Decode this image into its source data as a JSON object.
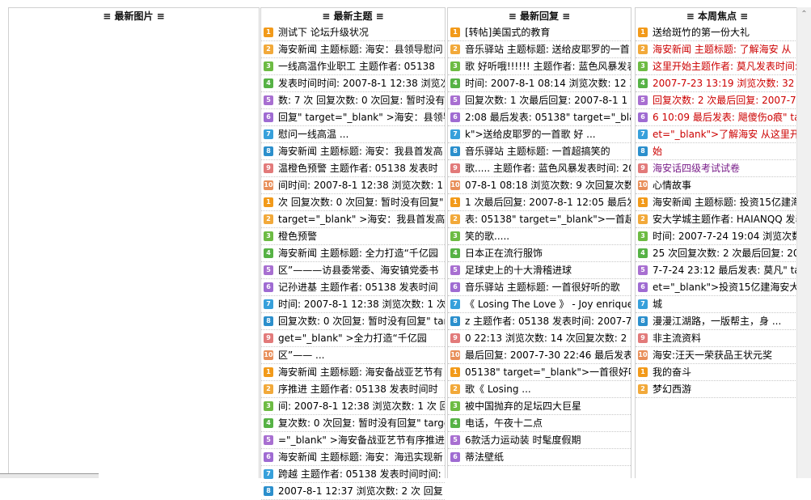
{
  "columns": {
    "pics": {
      "title": "≡ 最新图片 ≡",
      "rows": []
    },
    "topics": {
      "title": "≡ 最新主题 ≡",
      "rows": [
        {
          "num": "1",
          "text": "测试下 论坛升级状况",
          "style": ""
        },
        {
          "num": "2",
          "text": "海安新闻 主题标题: 海安：县领导慰问",
          "style": ""
        },
        {
          "num": "3",
          "text": "一线高温作业职工 主题作者: 05138",
          "style": ""
        },
        {
          "num": "4",
          "text": "发表时间时间: 2007-8-1 12:38 浏览次",
          "style": ""
        },
        {
          "num": "5",
          "text": "数: 7 次 回复次数: 0 次回复: 暂时没有",
          "style": ""
        },
        {
          "num": "6",
          "text": "回复\" target=\"_blank\" >海安：县领导",
          "style": ""
        },
        {
          "num": "7",
          "text": "慰问一线高温 ...",
          "style": ""
        },
        {
          "num": "8",
          "text": "海安新闻 主题标题: 海安：我县首发高",
          "style": ""
        },
        {
          "num": "9",
          "text": "温橙色预警 主题作者: 05138 发表时",
          "style": ""
        },
        {
          "num": "10",
          "text": "间时间: 2007-8-1 12:38 浏览次数: 1",
          "style": ""
        },
        {
          "num": "1",
          "text": "次 回复次数: 0 次回复: 暂时没有回复\"",
          "style": ""
        },
        {
          "num": "2",
          "text": "target=\"_blank\" >海安：我县首发高温",
          "style": ""
        },
        {
          "num": "3",
          "text": "橙色预警",
          "style": ""
        },
        {
          "num": "4",
          "text": "海安新闻 主题标题: 全力打造“千亿园",
          "style": ""
        },
        {
          "num": "5",
          "text": "区”———访县委常委、海安镇党委书",
          "style": ""
        },
        {
          "num": "6",
          "text": "记孙进基 主题作者: 05138 发表时间",
          "style": ""
        },
        {
          "num": "7",
          "text": "时间: 2007-8-1 12:38 浏览次数: 1 次",
          "style": ""
        },
        {
          "num": "8",
          "text": "回复次数: 0 次回复: 暂时没有回复\" tar",
          "style": ""
        },
        {
          "num": "9",
          "text": "get=\"_blank\" >全力打造“千亿园",
          "style": ""
        },
        {
          "num": "10",
          "text": "区”—— ...",
          "style": ""
        },
        {
          "num": "1",
          "text": "海安新闻 主题标题: 海安备战亚艺节有",
          "style": ""
        },
        {
          "num": "2",
          "text": "序推进 主题作者: 05138 发表时间时",
          "style": ""
        },
        {
          "num": "3",
          "text": "间: 2007-8-1 12:38 浏览次数: 1 次 回",
          "style": ""
        },
        {
          "num": "4",
          "text": "复次数: 0 次回复: 暂时没有回复\" target",
          "style": ""
        },
        {
          "num": "5",
          "text": "=\"_blank\" >海安备战亚艺节有序推进",
          "style": ""
        },
        {
          "num": "6",
          "text": "海安新闻 主题标题: 海安：海迅实现新",
          "style": ""
        },
        {
          "num": "7",
          "text": "跨越 主题作者: 05138 发表时间时间:",
          "style": ""
        },
        {
          "num": "8",
          "text": "2007-8-1 12:37 浏览次数: 2 次 回复",
          "style": ""
        }
      ]
    },
    "replies": {
      "title": "≡ 最新回复 ≡",
      "rows": [
        {
          "num": "1",
          "text": "[转帖]美国式的教育",
          "style": ""
        },
        {
          "num": "2",
          "text": "音乐驿站 主题标题: 送给皮耶罗的一首",
          "style": ""
        },
        {
          "num": "3",
          "text": "歌 好听哦!!!!!! 主题作者: 蓝色风暴发表",
          "style": ""
        },
        {
          "num": "4",
          "text": "时间: 2007-8-1 08:14 浏览次数: 12 次",
          "style": ""
        },
        {
          "num": "5",
          "text": "回复次数: 1 次最后回复: 2007-8-1 1",
          "style": ""
        },
        {
          "num": "6",
          "text": "2:08 最后发表: 05138\" target=\"_blan",
          "style": ""
        },
        {
          "num": "7",
          "text": "k\">送给皮耶罗的一首歌 好 ...",
          "style": ""
        },
        {
          "num": "8",
          "text": "音乐驿站 主题标题: 一首超搞笑的",
          "style": ""
        },
        {
          "num": "9",
          "text": "歌..... 主题作者: 蓝色风暴发表时间: 20",
          "style": ""
        },
        {
          "num": "10",
          "text": "07-8-1 08:18 浏览次数: 9 次回复次数:",
          "style": ""
        },
        {
          "num": "1",
          "text": "1 次最后回复: 2007-8-1 12:05 最后发",
          "style": ""
        },
        {
          "num": "2",
          "text": "表: 05138\" target=\"_blank\">一首超搞",
          "style": ""
        },
        {
          "num": "3",
          "text": "笑的歌.....",
          "style": ""
        },
        {
          "num": "4",
          "text": "日本正在流行服饰",
          "style": ""
        },
        {
          "num": "5",
          "text": "足球史上的十大滑稽进球",
          "style": ""
        },
        {
          "num": "6",
          "text": "音乐驿站 主题标题: 一首很好听的歌",
          "style": ""
        },
        {
          "num": "7",
          "text": "《 Losing The Love 》 - Joy enrique",
          "style": ""
        },
        {
          "num": "8",
          "text": "z 主题作者: 05138 发表时间: 2007-7-3",
          "style": ""
        },
        {
          "num": "9",
          "text": "0 22:13 浏览次数: 14 次回复次数: 2 次",
          "style": ""
        },
        {
          "num": "10",
          "text": "最后回复: 2007-7-30 22:46 最后发表:",
          "style": ""
        },
        {
          "num": "1",
          "text": "05138\" target=\"_blank\">一首很好听的",
          "style": ""
        },
        {
          "num": "2",
          "text": "歌《 Losing ...",
          "style": ""
        },
        {
          "num": "3",
          "text": "被中国抛弃的足坛四大巨星",
          "style": ""
        },
        {
          "num": "4",
          "text": "电话，午夜十二点",
          "style": ""
        },
        {
          "num": "5",
          "text": "6款活力运动装 时髦度假期",
          "style": ""
        },
        {
          "num": "6",
          "text": "蒂法壁纸",
          "style": ""
        }
      ]
    },
    "focus": {
      "title": "≡ 本周焦点 ≡",
      "rows": [
        {
          "num": "1",
          "text": "送给斑竹的第一份大礼",
          "style": ""
        },
        {
          "num": "2",
          "text": "海安新闻 主题标题: 了解海安 从",
          "style": "red"
        },
        {
          "num": "3",
          "text": "这里开始主题作者: 莫凡发表时间:",
          "style": "red"
        },
        {
          "num": "4",
          "text": "2007-7-23 13:19 浏览次数: 32 次",
          "style": "red"
        },
        {
          "num": "5",
          "text": "回复次数: 2 次最后回复: 2007-7-2",
          "style": "red"
        },
        {
          "num": "6",
          "text": "6 10:09 最后发表: 飓傻伤o痕\" targ",
          "style": "red"
        },
        {
          "num": "7",
          "text": "et=\"_blank\">了解海安 从这里开",
          "style": "red"
        },
        {
          "num": "8",
          "text": "始",
          "style": "red"
        },
        {
          "num": "9",
          "text": "海安话四级考试试卷",
          "style": "purple"
        },
        {
          "num": "10",
          "text": "心情故事",
          "style": ""
        },
        {
          "num": "1",
          "text": "海安新闻 主题标题: 投资15亿建海",
          "style": ""
        },
        {
          "num": "2",
          "text": "安大学城主题作者: HAIANQQ 发表",
          "style": ""
        },
        {
          "num": "3",
          "text": "时间: 2007-7-24 19:04 浏览次数:",
          "style": ""
        },
        {
          "num": "4",
          "text": "25 次回复次数: 2 次最后回复: 200",
          "style": ""
        },
        {
          "num": "5",
          "text": "7-7-24 23:12 最后发表: 莫凡\" targ",
          "style": ""
        },
        {
          "num": "6",
          "text": "et=\"_blank\">投资15亿建海安大学",
          "style": ""
        },
        {
          "num": "7",
          "text": "城",
          "style": ""
        },
        {
          "num": "8",
          "text": "漫漫江湖路，一版帮主，身 ...",
          "style": ""
        },
        {
          "num": "9",
          "text": "非主流资料",
          "style": ""
        },
        {
          "num": "10",
          "text": "海安:汪天一荣获品王状元奖",
          "style": ""
        },
        {
          "num": "1",
          "text": "我的奋斗",
          "style": ""
        },
        {
          "num": "2",
          "text": "梦幻西游",
          "style": ""
        }
      ]
    }
  },
  "scrollbar": {
    "up_arrow": "⌃"
  },
  "badge_colors": [
    "#f29a1a",
    "#f2a93a",
    "#6dbb43",
    "#56b245",
    "#a86fd1",
    "#9f6bd2",
    "#37a0db",
    "#2b8fcc",
    "#e27a7a",
    "#e88f5a"
  ]
}
